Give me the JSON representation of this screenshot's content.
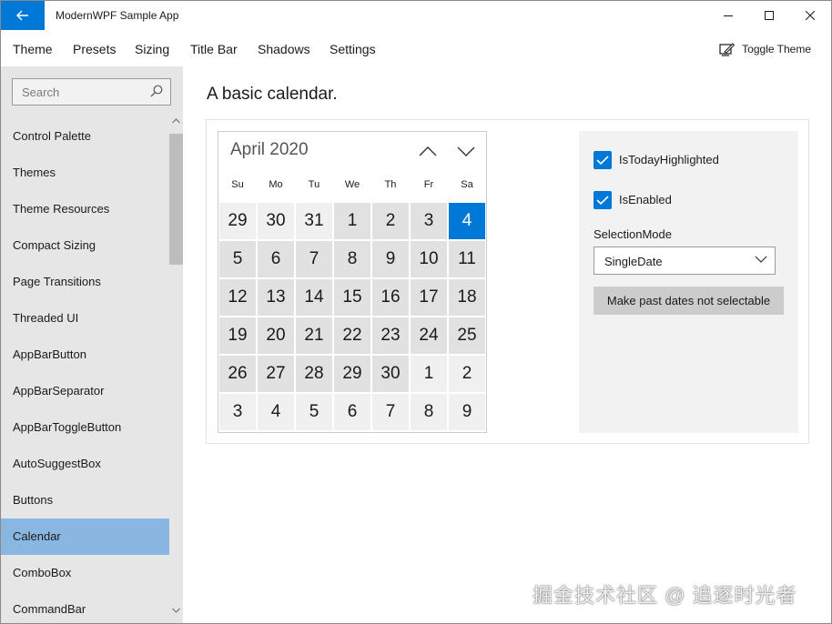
{
  "window": {
    "title": "ModernWPF Sample App"
  },
  "menu": {
    "items": [
      "Theme",
      "Presets",
      "Sizing",
      "Title Bar",
      "Shadows",
      "Settings"
    ],
    "toggle_theme_label": "Toggle Theme"
  },
  "sidebar": {
    "search_placeholder": "Search",
    "items": [
      "Control Palette",
      "Themes",
      "Theme Resources",
      "Compact Sizing",
      "Page Transitions",
      "Threaded UI",
      "AppBarButton",
      "AppBarSeparator",
      "AppBarToggleButton",
      "AutoSuggestBox",
      "Buttons",
      "Calendar",
      "ComboBox",
      "CommandBar"
    ],
    "selected": "Calendar"
  },
  "page": {
    "header": "A basic calendar."
  },
  "calendar": {
    "month_label": "April 2020",
    "days_of_week": [
      "Su",
      "Mo",
      "Tu",
      "We",
      "Th",
      "Fr",
      "Sa"
    ],
    "weeks": [
      [
        "29",
        "30",
        "31",
        "1",
        "2",
        "3",
        "4"
      ],
      [
        "5",
        "6",
        "7",
        "8",
        "9",
        "10",
        "11"
      ],
      [
        "12",
        "13",
        "14",
        "15",
        "16",
        "17",
        "18"
      ],
      [
        "19",
        "20",
        "21",
        "22",
        "23",
        "24",
        "25"
      ],
      [
        "26",
        "27",
        "28",
        "29",
        "30",
        "1",
        "2"
      ],
      [
        "3",
        "4",
        "5",
        "6",
        "7",
        "8",
        "9"
      ]
    ],
    "today": "4"
  },
  "options": {
    "is_today_highlighted": {
      "label": "IsTodayHighlighted",
      "checked": true
    },
    "is_enabled": {
      "label": "IsEnabled",
      "checked": true
    },
    "selection_mode_label": "SelectionMode",
    "selection_mode_value": "SingleDate",
    "past_dates_button": "Make past dates not selectable"
  },
  "watermark": "掘金技术社区 @ 追逐时光者",
  "colors": {
    "accent": "#0078d7",
    "selected_nav": "#8ab7e2",
    "sidebar_bg": "#e6e6e6"
  }
}
